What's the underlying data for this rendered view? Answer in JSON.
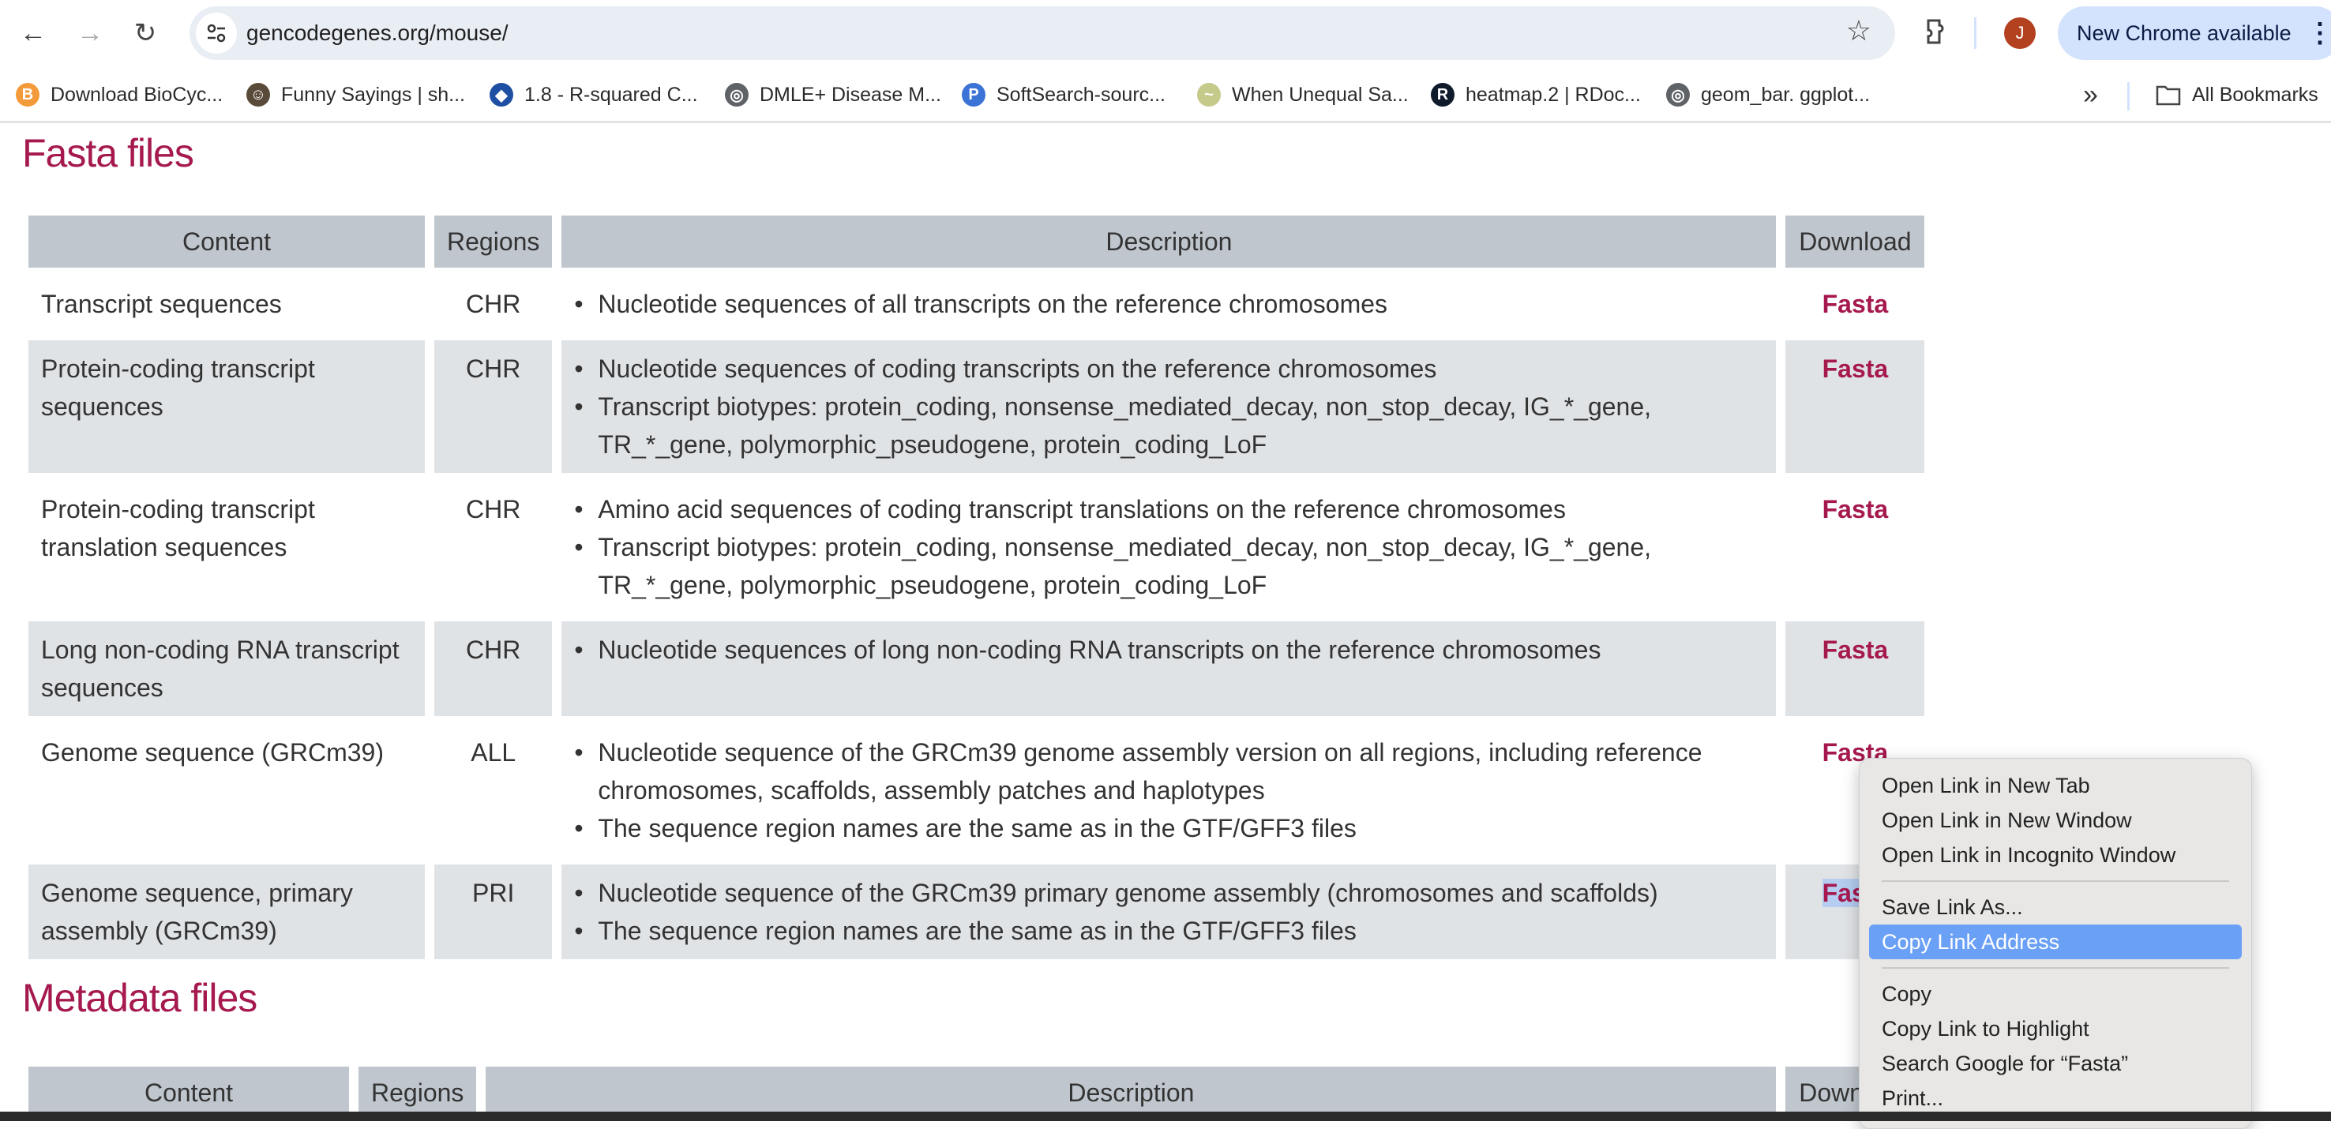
{
  "browser": {
    "url": "gencodegenes.org/mouse/",
    "avatar_letter": "J",
    "update_label": "New Chrome available",
    "bookmarks": [
      {
        "label": "Download BioCyc...",
        "icon": "biocyc-icon",
        "color": "#f39a3a",
        "glyph": "B"
      },
      {
        "label": "Funny Sayings | sh...",
        "icon": "funny-sayings-icon",
        "color": "#5a4a3a",
        "glyph": "☺"
      },
      {
        "label": "1.8 - R-squared C...",
        "icon": "psu-shield-icon",
        "color": "#1e4fa3",
        "glyph": "◆"
      },
      {
        "label": "DMLE+ Disease M...",
        "icon": "globe-icon",
        "color": "#5f6368",
        "glyph": "◎"
      },
      {
        "label": "SoftSearch-sourc...",
        "icon": "softsearch-icon",
        "color": "#3b73d6",
        "glyph": "P"
      },
      {
        "label": "When Unequal Sa...",
        "icon": "chart-circle-icon",
        "color": "#c5c98a",
        "glyph": "~"
      },
      {
        "label": "heatmap.2 | RDoc...",
        "icon": "rdocumentation-icon",
        "color": "#0f1a2a",
        "glyph": "R"
      },
      {
        "label": "geom_bar. ggplot...",
        "icon": "globe-icon",
        "color": "#5f6368",
        "glyph": "◎"
      }
    ],
    "all_bookmarks_label": "All Bookmarks"
  },
  "fasta": {
    "title": "Fasta files",
    "headers": [
      "Content",
      "Regions",
      "Description",
      "Download"
    ],
    "rows": [
      {
        "content": "Transcript sequences",
        "region": "CHR",
        "desc": [
          "Nucleotide sequences of all transcripts on the reference chromosomes"
        ],
        "download": "Fasta"
      },
      {
        "content": "Protein-coding transcript sequences",
        "region": "CHR",
        "desc": [
          "Nucleotide sequences of coding transcripts on the reference chromosomes",
          "Transcript biotypes: protein_coding, nonsense_mediated_decay, non_stop_decay, IG_*_gene, TR_*_gene, polymorphic_pseudogene, protein_coding_LoF"
        ],
        "download": "Fasta"
      },
      {
        "content": "Protein-coding transcript translation sequences",
        "region": "CHR",
        "desc": [
          "Amino acid sequences of coding transcript translations on the reference chromosomes",
          "Transcript biotypes: protein_coding, nonsense_mediated_decay, non_stop_decay, IG_*_gene, TR_*_gene, polymorphic_pseudogene, protein_coding_LoF"
        ],
        "download": "Fasta"
      },
      {
        "content": "Long non-coding RNA transcript sequences",
        "region": "CHR",
        "desc": [
          "Nucleotide sequences of long non-coding RNA transcripts on the reference chromosomes"
        ],
        "download": "Fasta"
      },
      {
        "content": "Genome sequence (GRCm39)",
        "region": "ALL",
        "desc": [
          "Nucleotide sequence of the GRCm39 genome assembly version on all regions, including reference chromosomes, scaffolds, assembly patches and haplotypes",
          "The sequence region names are the same as in the GTF/GFF3 files"
        ],
        "download": "Fasta"
      },
      {
        "content": "Genome sequence, primary assembly (GRCm39)",
        "region": "PRI",
        "desc": [
          "Nucleotide sequence of the GRCm39 primary genome assembly (chromosomes and scaffolds)",
          "The sequence region names are the same as in the GTF/GFF3 files"
        ],
        "download": "Fasta"
      }
    ]
  },
  "metadata": {
    "title": "Metadata files",
    "headers": [
      "Content",
      "Regions",
      "Description",
      "Download"
    ]
  },
  "context_menu": {
    "groups": [
      [
        "Open Link in New Tab",
        "Open Link in New Window",
        "Open Link in Incognito Window"
      ],
      [
        "Save Link As...",
        "Copy Link Address"
      ],
      [
        "Copy",
        "Copy Link to Highlight",
        "Search Google for “Fasta”",
        "Print..."
      ]
    ],
    "highlighted": "Copy Link Address"
  }
}
